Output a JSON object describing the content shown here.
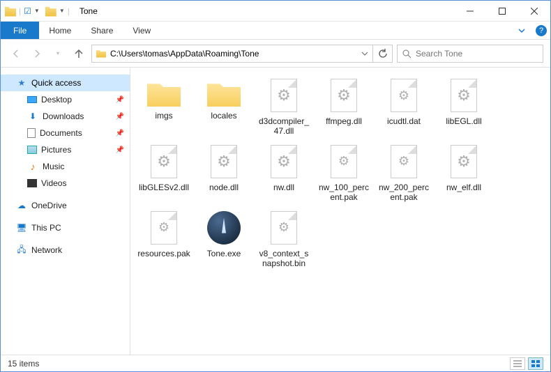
{
  "window": {
    "title": "Tone"
  },
  "ribbon": {
    "file_label": "File",
    "tabs": [
      {
        "label": "Home"
      },
      {
        "label": "Share"
      },
      {
        "label": "View"
      }
    ]
  },
  "address": {
    "path": "C:\\Users\\tomas\\AppData\\Roaming\\Tone",
    "search_placeholder": "Search Tone"
  },
  "sidebar": {
    "quick_access": "Quick access",
    "quick_items": [
      {
        "name": "desktop",
        "label": "Desktop",
        "pinned": true
      },
      {
        "name": "downloads",
        "label": "Downloads",
        "pinned": true
      },
      {
        "name": "documents",
        "label": "Documents",
        "pinned": true
      },
      {
        "name": "pictures",
        "label": "Pictures",
        "pinned": true
      },
      {
        "name": "music",
        "label": "Music",
        "pinned": false
      },
      {
        "name": "videos",
        "label": "Videos",
        "pinned": false
      }
    ],
    "onedrive": "OneDrive",
    "this_pc": "This PC",
    "network": "Network"
  },
  "files": [
    {
      "icon": "folder",
      "label": "imgs"
    },
    {
      "icon": "folder",
      "label": "locales"
    },
    {
      "icon": "dll",
      "label": "d3dcompiler_47.dll"
    },
    {
      "icon": "dll",
      "label": "ffmpeg.dll"
    },
    {
      "icon": "file",
      "label": "icudtl.dat"
    },
    {
      "icon": "dll",
      "label": "libEGL.dll"
    },
    {
      "icon": "dll",
      "label": "libGLESv2.dll"
    },
    {
      "icon": "dll",
      "label": "node.dll"
    },
    {
      "icon": "dll",
      "label": "nw.dll"
    },
    {
      "icon": "file",
      "label": "nw_100_percent.pak"
    },
    {
      "icon": "file",
      "label": "nw_200_percent.pak"
    },
    {
      "icon": "dll",
      "label": "nw_elf.dll"
    },
    {
      "icon": "file",
      "label": "resources.pak"
    },
    {
      "icon": "exe",
      "label": "Tone.exe"
    },
    {
      "icon": "file",
      "label": "v8_context_snapshot.bin"
    }
  ],
  "status": {
    "count_label": "15 items"
  }
}
